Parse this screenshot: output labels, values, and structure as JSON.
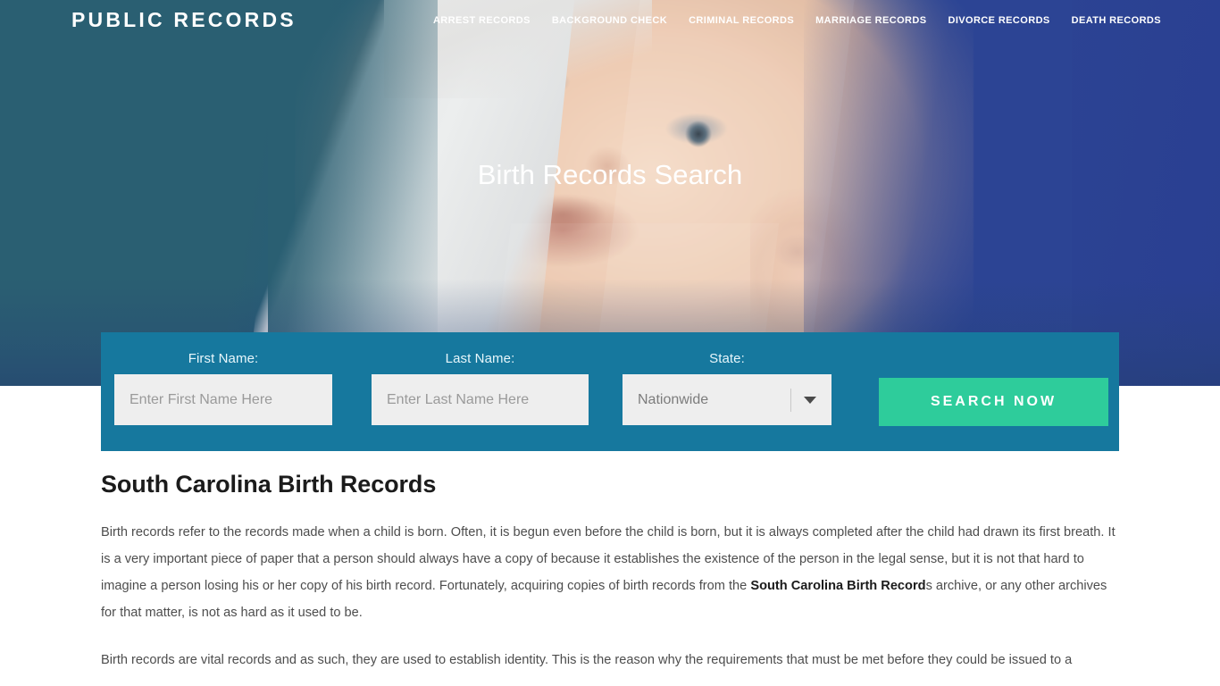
{
  "header": {
    "brand": "PUBLIC RECORDS",
    "nav": [
      {
        "label": "ARREST RECORDS",
        "name": "nav-arrest-records"
      },
      {
        "label": "BACKGROUND CHECK",
        "name": "nav-background-check"
      },
      {
        "label": "CRIMINAL RECORDS",
        "name": "nav-criminal-records"
      },
      {
        "label": "MARRIAGE RECORDS",
        "name": "nav-marriage-records"
      },
      {
        "label": "DIVORCE RECORDS",
        "name": "nav-divorce-records"
      },
      {
        "label": "DEATH RECORDS",
        "name": "nav-death-records"
      }
    ]
  },
  "hero": {
    "title": "Birth Records Search",
    "image_subject": "baby-photo"
  },
  "search": {
    "first_name_label": "First Name:",
    "first_name_placeholder": "Enter First Name Here",
    "first_name_value": "",
    "last_name_label": "Last Name:",
    "last_name_placeholder": "Enter Last Name Here",
    "last_name_value": "",
    "state_label": "State:",
    "state_selected": "Nationwide",
    "submit_label": "SEARCH NOW"
  },
  "main": {
    "heading": "South Carolina Birth Records",
    "paragraph1_a": "Birth records refer to the records made when a child is born. Often, it is begun even before the child is born, but it is always completed after the child had drawn its first breath. It is a very important piece of paper that a person should always have a copy of because it establishes the existence of the person in the legal sense, but it is not that hard to imagine a person losing his or her copy of his birth record. Fortunately, acquiring copies of birth records from the ",
    "paragraph1_bold": "South Carolina Birth Record",
    "paragraph1_b": "s archive, or any other archives for that matter, is not as hard as it used to be.",
    "paragraph2": "Birth records are vital records and as such, they are used to establish identity. This is the reason why the requirements that must be met before they could be issued to a"
  },
  "colors": {
    "hero_left": "#2a5f72",
    "hero_right": "#2c4494",
    "form_bar": "#16789e",
    "accent_button": "#2ecc9b",
    "input_bg": "#eeeeee",
    "heading": "#1b1b1b",
    "body_text": "#4d4d4d"
  }
}
